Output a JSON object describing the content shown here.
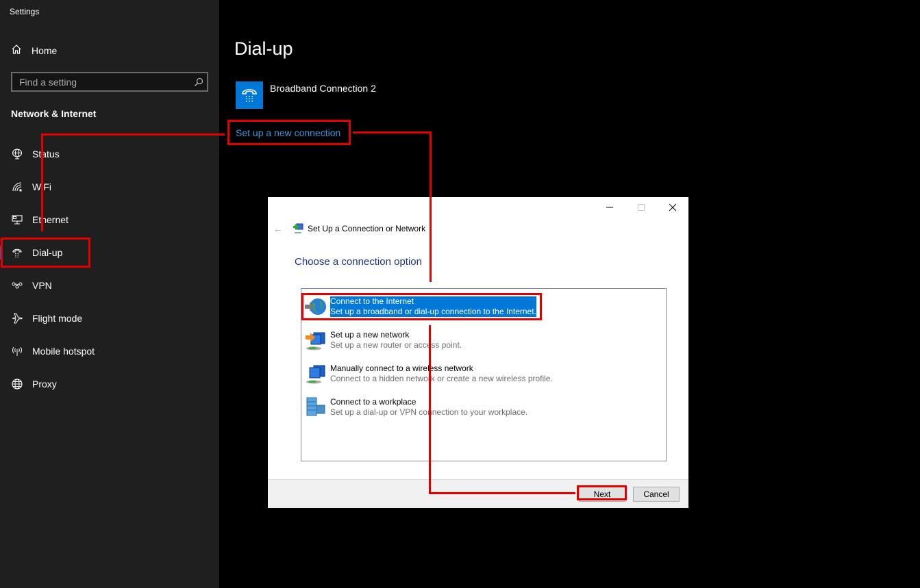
{
  "app": {
    "title": "Settings"
  },
  "sidebar": {
    "home_label": "Home",
    "search_placeholder": "Find a setting",
    "section_title": "Network & Internet",
    "items": [
      {
        "label": "Status",
        "icon": "status-globe-icon"
      },
      {
        "label": "WiFi",
        "icon": "wifi-icon"
      },
      {
        "label": "Ethernet",
        "icon": "ethernet-icon"
      },
      {
        "label": "Dial-up",
        "icon": "dial-up-phone-icon",
        "selected": true
      },
      {
        "label": "VPN",
        "icon": "vpn-icon"
      },
      {
        "label": "Flight mode",
        "icon": "airplane-icon"
      },
      {
        "label": "Mobile hotspot",
        "icon": "hotspot-icon"
      },
      {
        "label": "Proxy",
        "icon": "globe-icon"
      }
    ]
  },
  "main": {
    "title": "Dial-up",
    "connection_name": "Broadband Connection 2",
    "setup_link": "Set up a new connection"
  },
  "dialog": {
    "title": "Set Up a Connection or Network",
    "heading": "Choose a connection option",
    "options": [
      {
        "title": "Connect to the Internet",
        "desc": "Set up a broadband or dial-up connection to the Internet.",
        "selected": true
      },
      {
        "title": "Set up a new network",
        "desc": "Set up a new router or access point."
      },
      {
        "title": "Manually connect to a wireless network",
        "desc": "Connect to a hidden network or create a new wireless profile."
      },
      {
        "title": "Connect to a workplace",
        "desc": "Set up a dial-up or VPN connection to your workplace."
      }
    ],
    "next_label": "Next",
    "cancel_label": "Cancel"
  },
  "colors": {
    "accent": "#0078d7",
    "link": "#3a96dd",
    "annotation": "#e50000",
    "heading_blue": "#1e3287"
  }
}
